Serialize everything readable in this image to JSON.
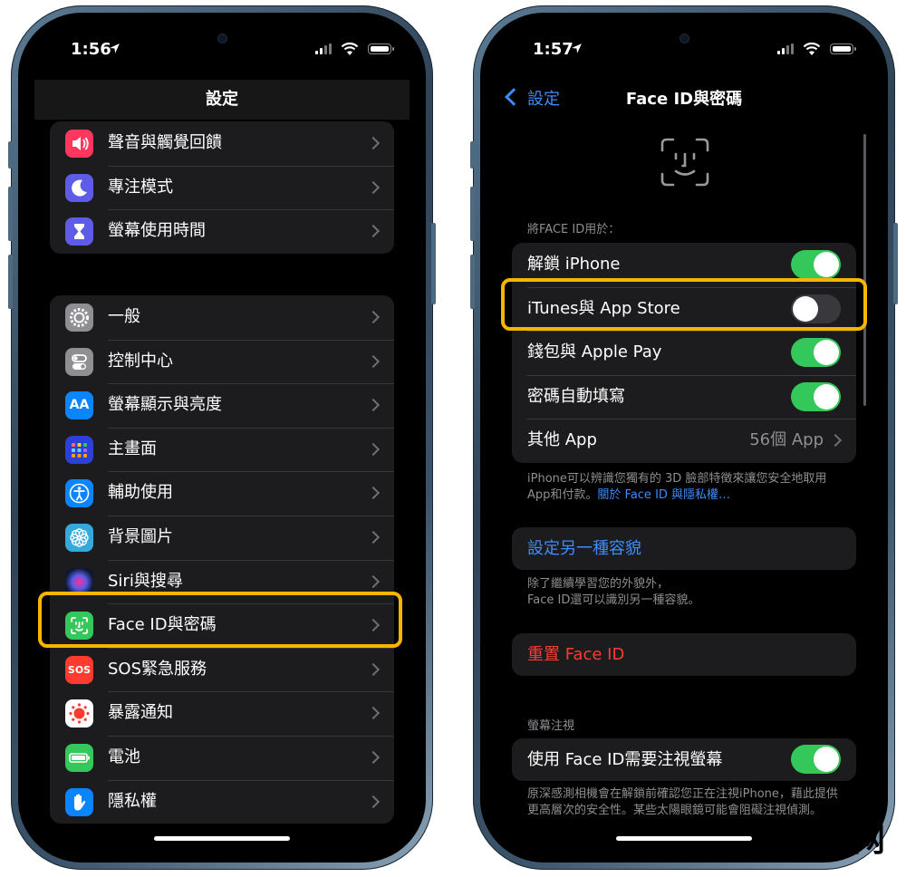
{
  "left": {
    "status": {
      "time": "1:56"
    },
    "nav": {
      "title": "設定"
    },
    "group1": [
      {
        "label": "聲音與觸覺回饋",
        "icon": "speaker-icon",
        "color": "#ff375f"
      },
      {
        "label": "專注模式",
        "icon": "moon-icon",
        "color": "#5e5ce6"
      },
      {
        "label": "螢幕使用時間",
        "icon": "hourglass-icon",
        "color": "#5e5ce6"
      }
    ],
    "group2": [
      {
        "label": "一般",
        "icon": "gear-icon",
        "color": "#8e8e93"
      },
      {
        "label": "控制中心",
        "icon": "toggles-icon",
        "color": "#8e8e93"
      },
      {
        "label": "螢幕顯示與亮度",
        "icon": "text-size-icon",
        "color": "#0a84ff",
        "glyph": "AA"
      },
      {
        "label": "主畫面",
        "icon": "home-grid-icon",
        "color": "#2c3fd6"
      },
      {
        "label": "輔助使用",
        "icon": "accessibility-icon",
        "color": "#0a84ff"
      },
      {
        "label": "背景圖片",
        "icon": "flower-icon",
        "color": "#34aadc"
      },
      {
        "label": "Siri與搜尋",
        "icon": "siri-icon",
        "color": "#111"
      },
      {
        "label": "Face ID與密碼",
        "icon": "face-id-icon",
        "color": "#34c759"
      },
      {
        "label": "SOS緊急服務",
        "icon": "sos-icon",
        "color": "#ff3b30",
        "glyph": "SOS"
      },
      {
        "label": "暴露通知",
        "icon": "exposure-icon",
        "color": "#ffffff"
      },
      {
        "label": "電池",
        "icon": "battery-icon",
        "color": "#34c759"
      },
      {
        "label": "隱私權",
        "icon": "hand-icon",
        "color": "#0a84ff"
      }
    ]
  },
  "right": {
    "status": {
      "time": "1:57"
    },
    "nav": {
      "title": "Face ID與密碼",
      "back": "設定"
    },
    "use_header": "將FACE ID用於：",
    "toggles": [
      {
        "label": "解鎖 iPhone",
        "on": true
      },
      {
        "label": "iTunes與 App Store",
        "on": false
      },
      {
        "label": "錢包與 Apple Pay",
        "on": true
      },
      {
        "label": "密碼自動填寫",
        "on": true
      }
    ],
    "other_app": {
      "label": "其他 App",
      "value": "56個 App"
    },
    "footer1": "iPhone可以辨識您獨有的 3D 臉部特徵來讓您安全地取用App和付款。",
    "footer1_link": "關於 Face ID 與隱私權…",
    "alt_appearance": "設定另一種容貌",
    "footer2_line1": "除了繼續學習您的外貌外，",
    "footer2_line2": "Face ID還可以識別另一種容貌。",
    "reset": "重置 Face ID",
    "attention_header": "螢幕注視",
    "attention_toggle": {
      "label": "使用 Face ID需要注視螢幕",
      "on": true
    },
    "footer3": "原深感測相機會在解鎖前確認您正在注視iPhone，藉此提供更高層次的安全性。某些太陽眼鏡可能會阻礙注視偵測。"
  },
  "watermark": "搞趣网",
  "colors": {
    "highlight": "#f7b500",
    "link": "#3e8bff",
    "toggle_on": "#34c759",
    "danger": "#ff3b30"
  }
}
